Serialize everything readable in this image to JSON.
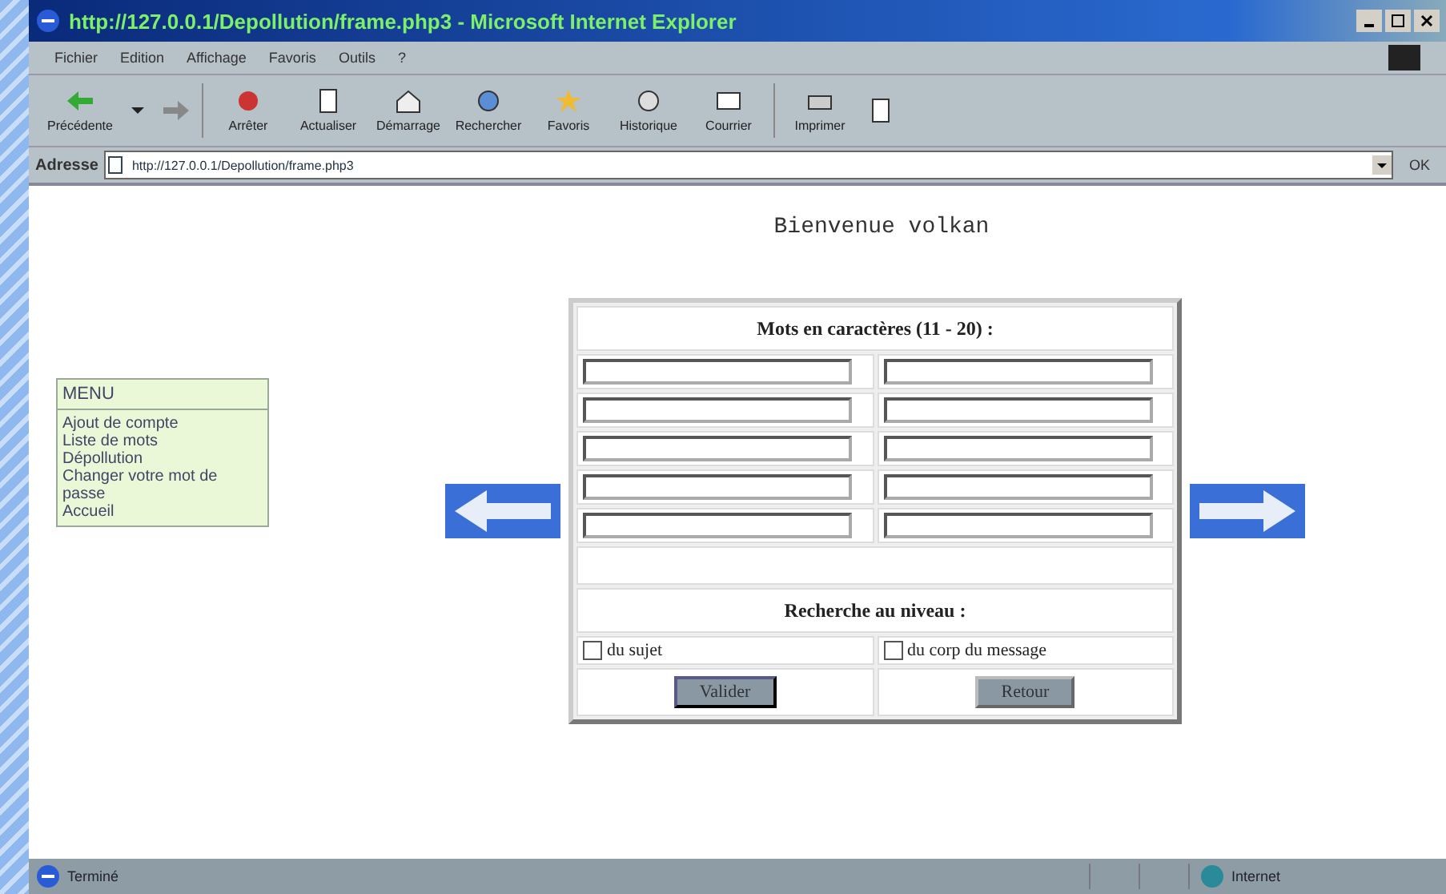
{
  "window": {
    "title": "http://127.0.0.1/Depollution/frame.php3 - Microsoft Internet Explorer"
  },
  "menu_bar": [
    "Fichier",
    "Edition",
    "Affichage",
    "Favoris",
    "Outils",
    "?"
  ],
  "toolbar": [
    {
      "kind": "labeled",
      "label": "Précédente"
    },
    {
      "kind": "icon"
    },
    {
      "kind": "icon"
    },
    {
      "kind": "labeled",
      "label": "Arrêter"
    },
    {
      "kind": "labeled",
      "label": "Actualiser"
    },
    {
      "kind": "labeled",
      "label": "Démarrage"
    },
    {
      "kind": "labeled",
      "label": "Rechercher"
    },
    {
      "kind": "labeled",
      "label": "Favoris"
    },
    {
      "kind": "labeled",
      "label": "Historique"
    },
    {
      "kind": "labeled",
      "label": "Courrier"
    },
    {
      "kind": "labeled",
      "label": "Imprimer"
    },
    {
      "kind": "icon"
    }
  ],
  "address_bar": {
    "label": "Adresse",
    "url": "http://127.0.0.1/Depollution/frame.php3",
    "go": "OK"
  },
  "page": {
    "greeting": "Bienvenue volkan",
    "menu": {
      "title": "MENU",
      "items": [
        "Ajout de compte",
        "Liste de mots",
        "Dépollution",
        "Changer votre mot de passe",
        "Accueil"
      ]
    },
    "form": {
      "heading": "Mots en caractères (11 - 20) :",
      "search_heading": "Recherche au niveau :",
      "options": [
        {
          "label": "du sujet",
          "checked": false
        },
        {
          "label": "du corp du message",
          "checked": false
        }
      ],
      "buttons": [
        "Valider",
        "Retour"
      ]
    }
  },
  "status_bar": {
    "text": "Terminé",
    "zone": "Internet"
  }
}
